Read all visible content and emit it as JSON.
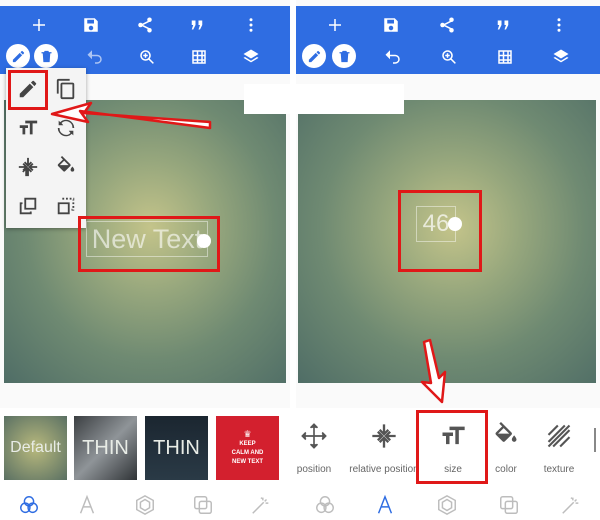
{
  "left": {
    "canvas_text": "New Text",
    "thumbnails": [
      {
        "label": "Default",
        "bg": "#7d8d68"
      },
      {
        "label": "THIN",
        "bg": "#5f6468"
      },
      {
        "label": "THIN",
        "bg": "#1c2730"
      },
      {
        "label": "KEEP CALM AND NEW TEXT",
        "bg": "#d3202e"
      }
    ],
    "popup_icons": [
      "pencil-icon",
      "copy-icon",
      "text-size-icon",
      "rotate-icon",
      "center-icon",
      "fill-icon",
      "bring-front-icon",
      "send-back-icon"
    ]
  },
  "right": {
    "canvas_value": "46",
    "tools": [
      {
        "label": "position",
        "icon": "move-icon"
      },
      {
        "label": "relative position",
        "icon": "compress-icon"
      },
      {
        "label": "size",
        "icon": "text-size-icon"
      },
      {
        "label": "color",
        "icon": "fill-icon"
      },
      {
        "label": "texture",
        "icon": "texture-icon"
      }
    ]
  },
  "colors": {
    "toolbar": "#2f6de2",
    "highlight": "#e01818",
    "nav_active": "#2f6de2",
    "nav_inactive": "#bdbdbd"
  }
}
